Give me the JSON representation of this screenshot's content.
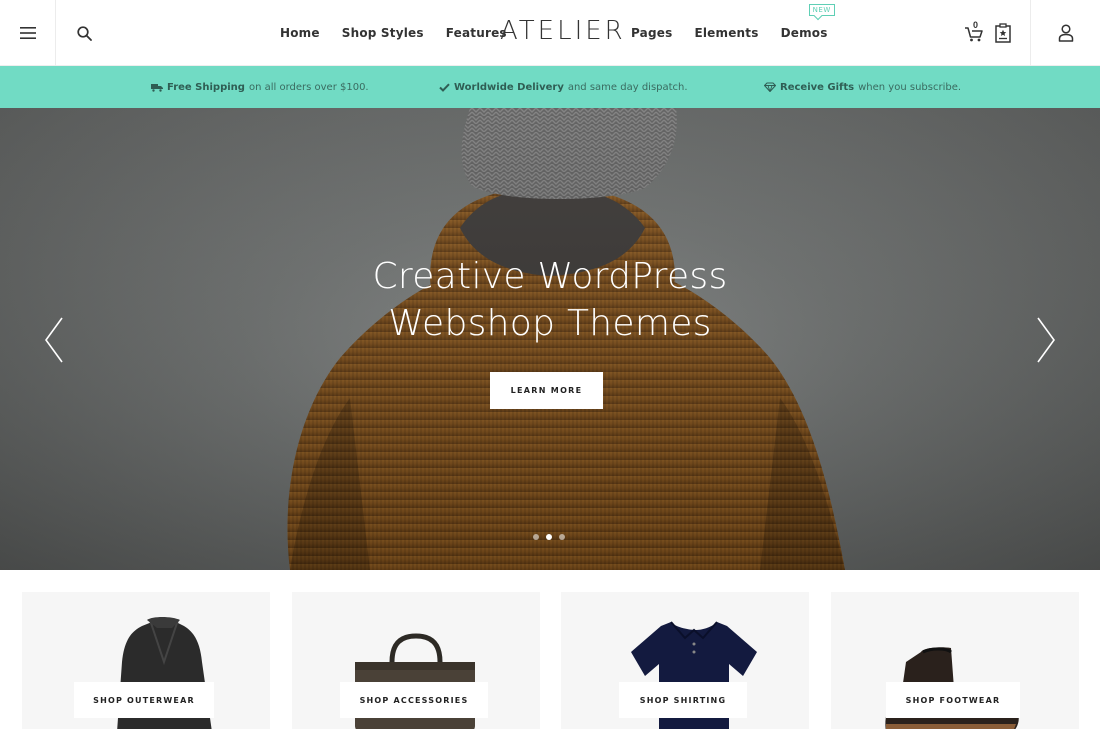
{
  "header": {
    "logo": "ATELIER",
    "nav_left": [
      "Home",
      "Shop Styles",
      "Features"
    ],
    "nav_right": [
      "Pages",
      "Elements",
      "Demos"
    ],
    "new_badge": "NEW",
    "cart_count": "0"
  },
  "infobar": {
    "bg_color": "#71dbc4",
    "items": [
      {
        "icon": "truck-icon",
        "bold": "Free Shipping",
        "text": "on all orders over $100."
      },
      {
        "icon": "check-icon",
        "bold": "Worldwide Delivery",
        "text": "and same day dispatch."
      },
      {
        "icon": "diamond-icon",
        "bold": "Receive Gifts",
        "text": "when you subscribe."
      }
    ]
  },
  "hero": {
    "title_line1": "Creative WordPress",
    "title_line2": "Webshop Themes",
    "button": "LEARN MORE",
    "slide_count": 3,
    "active_slide": 2
  },
  "categories": [
    {
      "label": "SHOP OUTERWEAR",
      "icon": "coat-icon"
    },
    {
      "label": "SHOP ACCESSORIES",
      "icon": "bag-icon"
    },
    {
      "label": "SHOP SHIRTING",
      "icon": "shirt-icon"
    },
    {
      "label": "SHOP FOOTWEAR",
      "icon": "boots-icon"
    }
  ]
}
